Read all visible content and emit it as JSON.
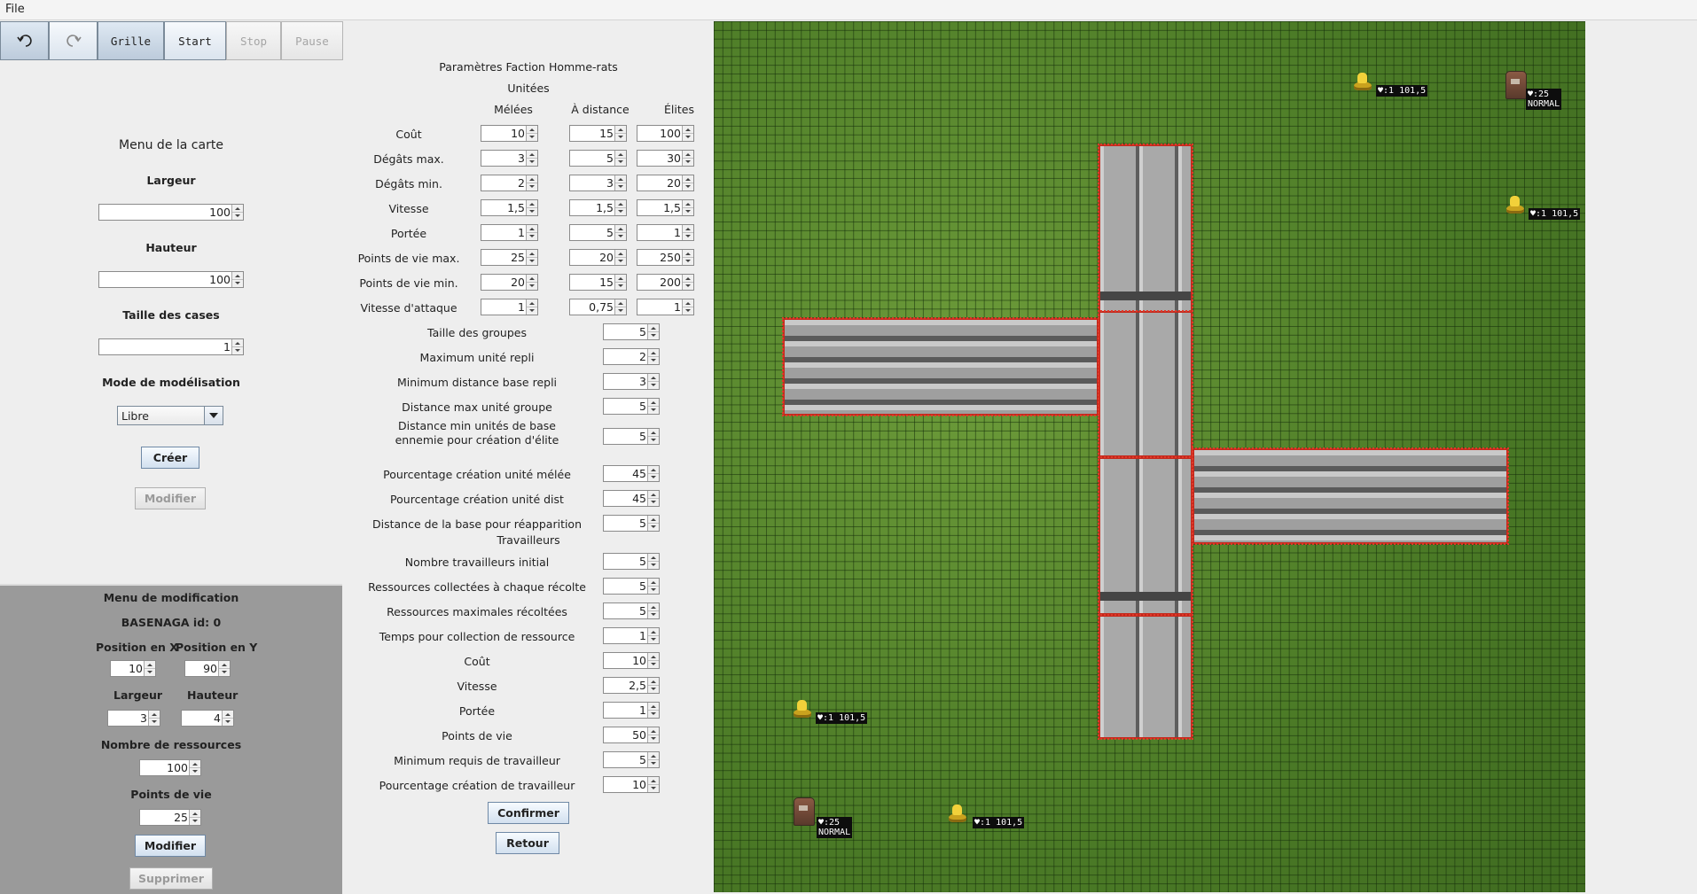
{
  "menubar": {
    "file": "File"
  },
  "toolbar": {
    "undo_icon": "undo-icon",
    "redo_icon": "redo-icon",
    "grid": "Grille",
    "start": "Start",
    "stop": "Stop",
    "pause": "Pause"
  },
  "map_menu": {
    "title": "Menu de la carte",
    "width_label": "Largeur",
    "width_value": "100",
    "height_label": "Hauteur",
    "height_value": "100",
    "cell_label": "Taille des cases",
    "cell_value": "1",
    "mode_label": "Mode de modélisation",
    "mode_value": "Libre",
    "create": "Créer",
    "modify": "Modifier"
  },
  "mod_menu": {
    "title": "Menu de modification",
    "entity": "BASENAGA id: 0",
    "posx_label": "Position en X",
    "posy_label": "Position en Y",
    "posx": "10",
    "posy": "90",
    "width_label": "Largeur",
    "height_label": "Hauteur",
    "width": "3",
    "height": "4",
    "res_label": "Nombre de ressources",
    "res": "100",
    "hp_label": "Points de vie",
    "hp": "25",
    "modify": "Modifier",
    "delete": "Supprimer"
  },
  "params": {
    "title": "Paramètres Faction Homme-rats",
    "units_header": "Unitées",
    "columns": [
      "Mélées",
      "À distance",
      "Élites"
    ],
    "unit_rows": [
      {
        "label": "Coût",
        "values": [
          "10",
          "15",
          "100"
        ]
      },
      {
        "label": "Dégâts max.",
        "values": [
          "3",
          "5",
          "30"
        ]
      },
      {
        "label": "Dégâts min.",
        "values": [
          "2",
          "3",
          "20"
        ]
      },
      {
        "label": "Vitesse",
        "values": [
          "1,5",
          "1,5",
          "1,5"
        ]
      },
      {
        "label": "Portée",
        "values": [
          "1",
          "5",
          "1"
        ]
      },
      {
        "label": "Points de vie max.",
        "values": [
          "25",
          "20",
          "250"
        ]
      },
      {
        "label": "Points de vie min.",
        "values": [
          "20",
          "15",
          "200"
        ]
      },
      {
        "label": "Vitesse d'attaque",
        "values": [
          "1",
          "0,75",
          "1"
        ]
      }
    ],
    "group_rows": [
      {
        "label": "Taille des groupes",
        "value": "5"
      },
      {
        "label": "Maximum unité repli",
        "value": "2"
      },
      {
        "label": "Minimum distance base repli",
        "value": "3"
      },
      {
        "label": "Distance max unité groupe",
        "value": "5"
      },
      {
        "label": "Distance min unités de base",
        "label2": "ennemie pour création d'élite",
        "value": "5"
      },
      {
        "label": "Pourcentage création unité mélée",
        "value": "45"
      },
      {
        "label": "Pourcentage création unité dist",
        "value": "45"
      },
      {
        "label": "Distance de la base pour réapparition",
        "value": "5"
      }
    ],
    "workers_header": "Travailleurs",
    "worker_rows": [
      {
        "label": "Nombre travailleurs initial",
        "value": "5"
      },
      {
        "label": "Ressources collectées à chaque récolte",
        "value": "5"
      },
      {
        "label": "Ressources maximales récoltées",
        "value": "5"
      },
      {
        "label": "Temps pour collection de ressource",
        "value": "1"
      },
      {
        "label": "Coût",
        "value": "10"
      },
      {
        "label": "Vitesse",
        "value": "2,5"
      },
      {
        "label": "Portée",
        "value": "1"
      },
      {
        "label": "Points de vie",
        "value": "50"
      },
      {
        "label": "Minimum requis de travailleur",
        "value": "5"
      },
      {
        "label": "Pourcentage création de travailleur",
        "value": "10"
      }
    ],
    "confirm": "Confirmer",
    "back": "Retour"
  },
  "map": {
    "resources": [
      {
        "label": "♥:1 101,5"
      },
      {
        "label": "♥:1 101,5"
      },
      {
        "label": "♥:1 101,5"
      },
      {
        "label": "♥:1 101,5"
      }
    ],
    "bases": [
      {
        "label": "♥:25\nNORMAL"
      },
      {
        "label": "♥:25\nNORMAL"
      }
    ]
  }
}
